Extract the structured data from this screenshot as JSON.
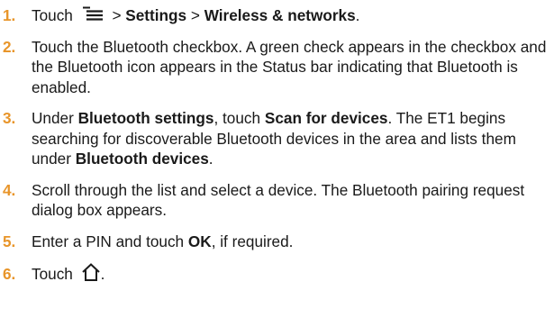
{
  "steps": [
    {
      "number": "1.",
      "text_a": "Touch",
      "icon": "menu-icon",
      "sep1": ">",
      "b1": "Settings",
      "sep2": ">",
      "b2": "Wireless & networks",
      "end": "."
    },
    {
      "number": "2.",
      "text": "Touch the Bluetooth checkbox. A green check appears in the checkbox and the Bluetooth icon appears in the Status bar indicating that Bluetooth is enabled."
    },
    {
      "number": "3.",
      "text_a": "Under",
      "b1": "Bluetooth settings",
      "text_b": ", touch",
      "b2": "Scan for devices",
      "text_c": ". The ET1 begins searching for discoverable Bluetooth devices in the area and lists them under",
      "b3": "Bluetooth devices",
      "end": "."
    },
    {
      "number": "4.",
      "text": "Scroll through the list and select a device. The Bluetooth pairing request dialog box appears."
    },
    {
      "number": "5.",
      "text_a": "Enter a PIN and touch",
      "b1": "OK",
      "text_b": ", if required."
    },
    {
      "number": "6.",
      "text_a": "Touch",
      "icon": "home-icon",
      "end": "."
    }
  ]
}
